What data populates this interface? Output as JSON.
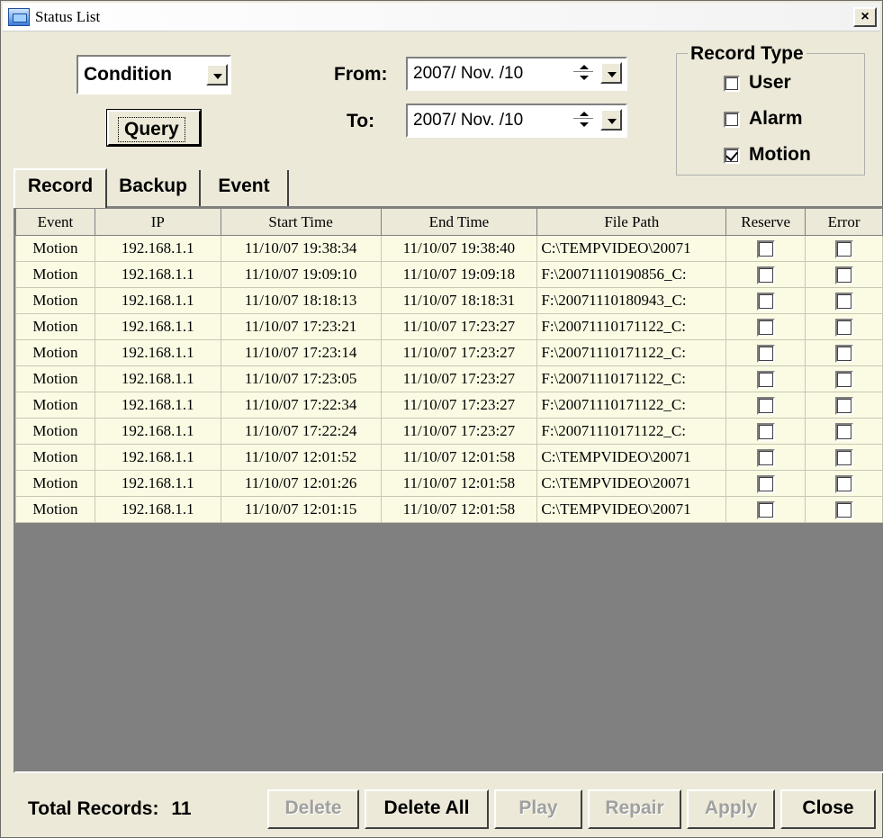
{
  "window": {
    "title": "Status List",
    "close_glyph": "×"
  },
  "condition": {
    "selected": "Condition"
  },
  "query_label": "Query",
  "from_label": "From:",
  "to_label": "To:",
  "from_value": "2007/ Nov. /10",
  "to_value": "2007/ Nov. /10",
  "record_type": {
    "title": "Record Type",
    "options": [
      {
        "label": "User",
        "checked": false
      },
      {
        "label": "Alarm",
        "checked": false
      },
      {
        "label": "Motion",
        "checked": true
      }
    ]
  },
  "tabs": [
    "Record",
    "Backup",
    "Event"
  ],
  "table": {
    "columns": [
      "Event",
      "IP",
      "Start Time",
      "End Time",
      "File Path",
      "Reserve",
      "Error"
    ],
    "rows": [
      [
        "Motion",
        "192.168.1.1",
        "11/10/07 19:38:34",
        "11/10/07 19:38:40",
        "C:\\TEMPVIDEO\\20071"
      ],
      [
        "Motion",
        "192.168.1.1",
        "11/10/07 19:09:10",
        "11/10/07 19:09:18",
        "F:\\20071110190856_C:"
      ],
      [
        "Motion",
        "192.168.1.1",
        "11/10/07 18:18:13",
        "11/10/07 18:18:31",
        "F:\\20071110180943_C:"
      ],
      [
        "Motion",
        "192.168.1.1",
        "11/10/07 17:23:21",
        "11/10/07 17:23:27",
        "F:\\20071110171122_C:"
      ],
      [
        "Motion",
        "192.168.1.1",
        "11/10/07 17:23:14",
        "11/10/07 17:23:27",
        "F:\\20071110171122_C:"
      ],
      [
        "Motion",
        "192.168.1.1",
        "11/10/07 17:23:05",
        "11/10/07 17:23:27",
        "F:\\20071110171122_C:"
      ],
      [
        "Motion",
        "192.168.1.1",
        "11/10/07 17:22:34",
        "11/10/07 17:23:27",
        "F:\\20071110171122_C:"
      ],
      [
        "Motion",
        "192.168.1.1",
        "11/10/07 17:22:24",
        "11/10/07 17:23:27",
        "F:\\20071110171122_C:"
      ],
      [
        "Motion",
        "192.168.1.1",
        "11/10/07 12:01:52",
        "11/10/07 12:01:58",
        "C:\\TEMPVIDEO\\20071"
      ],
      [
        "Motion",
        "192.168.1.1",
        "11/10/07 12:01:26",
        "11/10/07 12:01:58",
        "C:\\TEMPVIDEO\\20071"
      ],
      [
        "Motion",
        "192.168.1.1",
        "11/10/07 12:01:15",
        "11/10/07 12:01:58",
        "C:\\TEMPVIDEO\\20071"
      ]
    ]
  },
  "footer": {
    "total_label": "Total Records:",
    "total_count": "11",
    "buttons": {
      "delete": "Delete",
      "delete_all": "Delete All",
      "play": "Play",
      "repair": "Repair",
      "apply": "Apply",
      "close": "Close"
    }
  }
}
